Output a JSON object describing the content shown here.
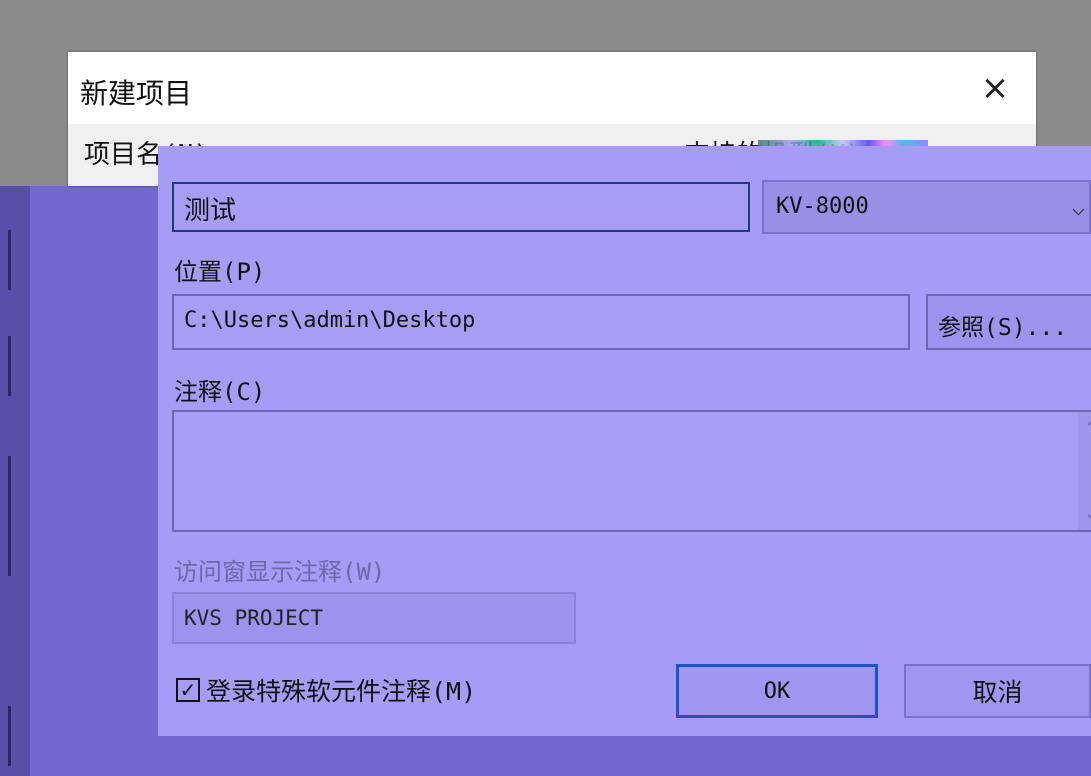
{
  "dialog": {
    "title": "新建项目",
    "close_icon": "×"
  },
  "fields": {
    "name_label": "项目名(N)",
    "name_value": "测试",
    "model_label": "支持的机型(K)",
    "model_value": "KV-8000",
    "location_label": "位置(P)",
    "location_value": "C:\\Users\\admin\\Desktop",
    "browse_label": "参照(S)...",
    "comment_label": "注释(C)",
    "comment_value": "",
    "viewer_comment_label": "访问窗显示注释(W)",
    "viewer_comment_value": "KVS PROJECT"
  },
  "options": {
    "register_label": "登录特殊软元件注释(M)",
    "register_checked": true,
    "checkbox_mark": "✓"
  },
  "buttons": {
    "ok_label": "OK",
    "cancel_label": "取消"
  },
  "icons": {
    "chevron": "⌵",
    "scroll_up": "⌃",
    "scroll_down": "⌄"
  }
}
